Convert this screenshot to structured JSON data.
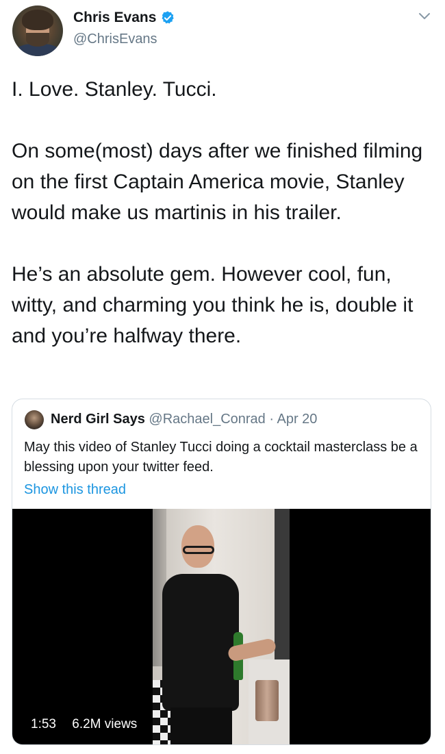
{
  "author": {
    "display_name": "Chris Evans",
    "handle": "@ChrisEvans"
  },
  "tweet": {
    "text": "I. Love. Stanley. Tucci.\n\nOn some(most) days after we finished filming on the first Captain America movie, Stanley would make us martinis in his trailer.\n\nHe’s an absolute gem. However cool, fun, witty, and charming you think he is, double it and you’re halfway there."
  },
  "quoted_tweet": {
    "display_name": "Nerd Girl Says",
    "handle": "@Rachael_Conrad",
    "separator": "·",
    "date": "Apr 20",
    "text": "May this video of Stanley Tucci doing a cocktail masterclass be a blessing upon your twitter feed.",
    "show_thread_label": "Show this thread",
    "video": {
      "duration": "1:53",
      "views": "6.2M views"
    }
  },
  "icons": {
    "verified": "verified-badge-icon",
    "caret": "chevron-down-icon"
  },
  "colors": {
    "text_primary": "#14171a",
    "text_secondary": "#657786",
    "link": "#1b95e0",
    "verified": "#1da1f2",
    "border": "#d6dde3"
  }
}
